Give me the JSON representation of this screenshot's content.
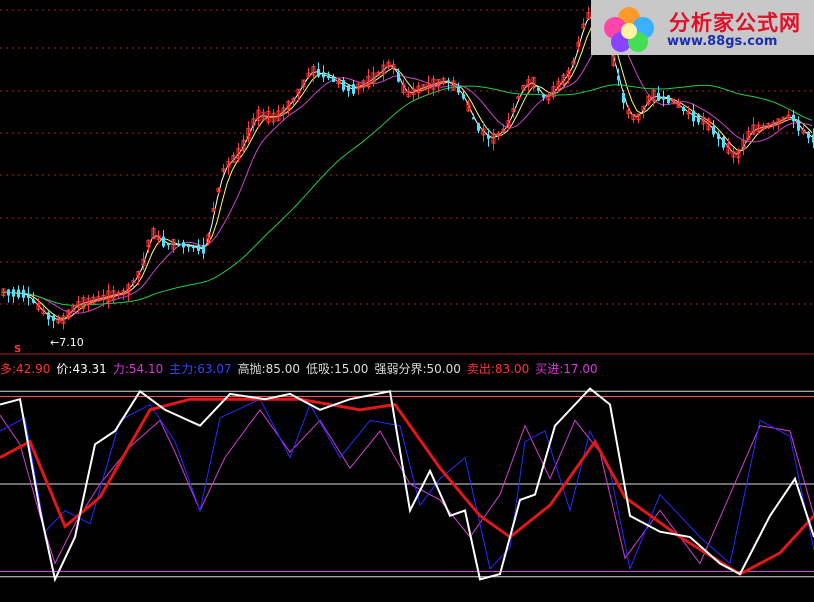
{
  "chart_data": [
    {
      "type": "candlestick",
      "title": "",
      "annotations": [
        {
          "text": "←7.10"
        },
        {
          "text": "S"
        }
      ],
      "series": [
        {
          "name": "",
          "color": "#ffffff"
        },
        {
          "name": "",
          "color": "#ffff66"
        },
        {
          "name": "",
          "color": "#cc44cc"
        },
        {
          "name": "",
          "color": "#22cc44"
        }
      ],
      "colors": {
        "up": "#ff3a3a",
        "down": "#55e0ff",
        "grid": "#aa1f1f"
      }
    },
    {
      "type": "line",
      "legend": [
        {
          "label": "多:",
          "value": "42.90",
          "color": "#ff3333"
        },
        {
          "label": "价:",
          "value": "43.31",
          "color": "#ffffff"
        },
        {
          "label": "力:",
          "value": "54.10",
          "color": "#dd33dd"
        },
        {
          "label": "主力:",
          "value": "63.07",
          "color": "#3344ff"
        },
        {
          "label": "高抛:",
          "value": "85.00",
          "color": "#dddddd"
        },
        {
          "label": "低吸:",
          "value": "15.00",
          "color": "#dddddd"
        },
        {
          "label": "强弱分界:",
          "value": "50.00",
          "color": "#dddddd"
        },
        {
          "label": "卖出:",
          "value": "83.00",
          "color": "#ff3333"
        },
        {
          "label": "买进:",
          "value": "17.00",
          "color": "#dd33dd"
        }
      ],
      "ylim": [
        10,
        90
      ],
      "levels": [
        85,
        83,
        50,
        17,
        15
      ],
      "series_colors": {
        "多": "#e01818",
        "价": "#ffffff",
        "力": "#d040d0",
        "主力": "#2a2aff"
      }
    }
  ],
  "logo": {
    "title": "分析家公式网",
    "url": "www.88gs.com"
  }
}
